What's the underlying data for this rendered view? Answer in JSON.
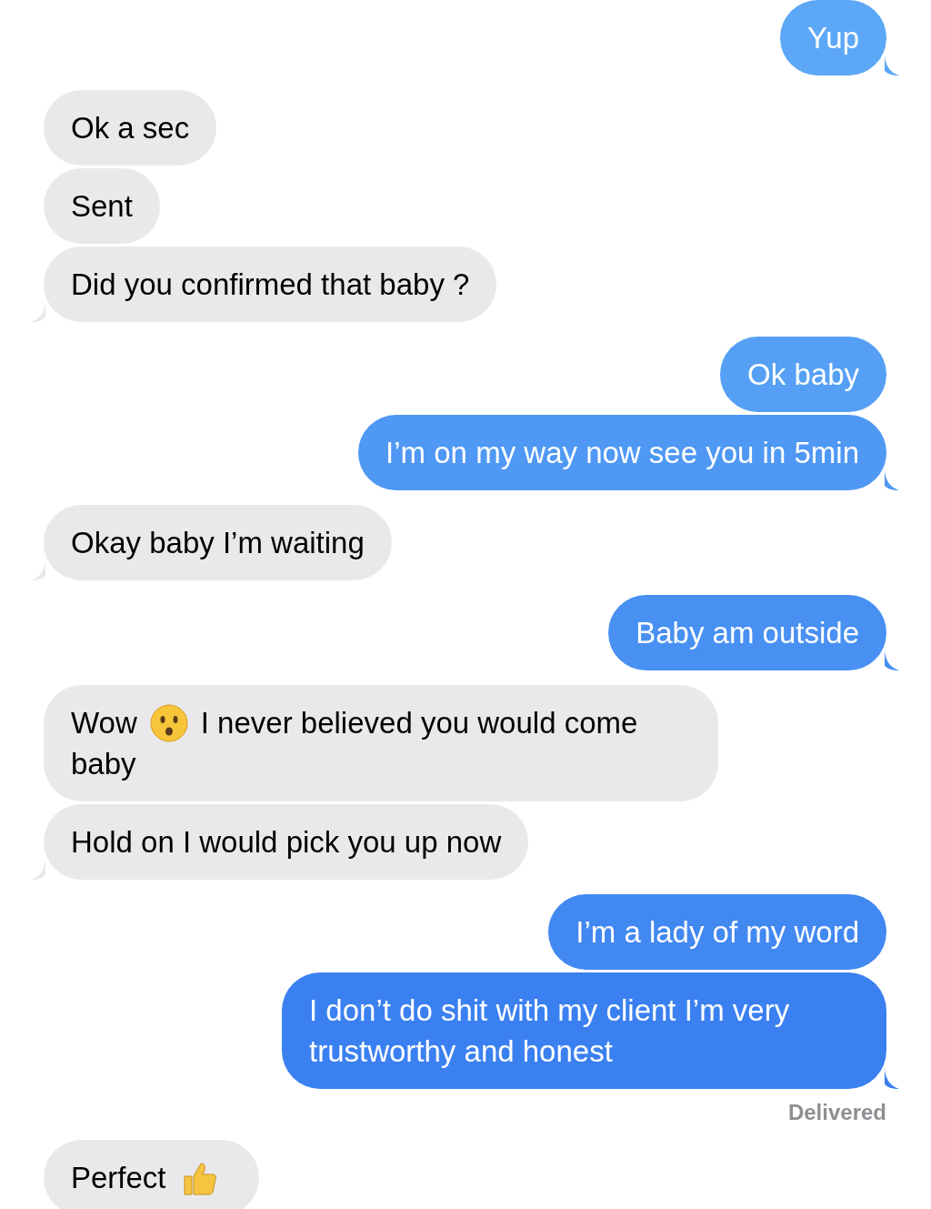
{
  "messages": [
    {
      "sent": true,
      "parts": [
        {
          "kind": "text",
          "text": "Yup"
        }
      ]
    },
    {
      "sent": false,
      "parts": [
        {
          "kind": "text",
          "text": "Ok a sec"
        }
      ]
    },
    {
      "sent": false,
      "parts": [
        {
          "kind": "text",
          "text": "Sent"
        }
      ]
    },
    {
      "sent": false,
      "parts": [
        {
          "kind": "text",
          "text": "Did you confirmed that baby ?"
        }
      ]
    },
    {
      "sent": true,
      "parts": [
        {
          "kind": "text",
          "text": "Ok baby"
        }
      ]
    },
    {
      "sent": true,
      "parts": [
        {
          "kind": "text",
          "text": "I’m on my way now see you in 5min"
        }
      ]
    },
    {
      "sent": false,
      "parts": [
        {
          "kind": "text",
          "text": "Okay baby I’m waiting"
        }
      ]
    },
    {
      "sent": true,
      "parts": [
        {
          "kind": "text",
          "text": "Baby am outside"
        }
      ]
    },
    {
      "sent": false,
      "parts": [
        {
          "kind": "text",
          "text": "Wow"
        },
        {
          "kind": "face"
        },
        {
          "kind": "text",
          "text": "I never believed you would come"
        },
        {
          "kind": "text",
          "text": "baby"
        }
      ]
    },
    {
      "sent": false,
      "parts": [
        {
          "kind": "text",
          "text": "Hold on I would pick you up now"
        }
      ]
    },
    {
      "sent": true,
      "parts": [
        {
          "kind": "text",
          "text": "I’m a lady of my word"
        }
      ]
    },
    {
      "sent": true,
      "parts": [
        {
          "kind": "text",
          "text": "I don’t do shit with my client I’m very trustworthy and honest"
        }
      ],
      "receipt": "Delivered"
    },
    {
      "sent": false,
      "parts": [
        {
          "kind": "text",
          "text": "Perfect"
        },
        {
          "kind": "thumb"
        }
      ]
    }
  ]
}
